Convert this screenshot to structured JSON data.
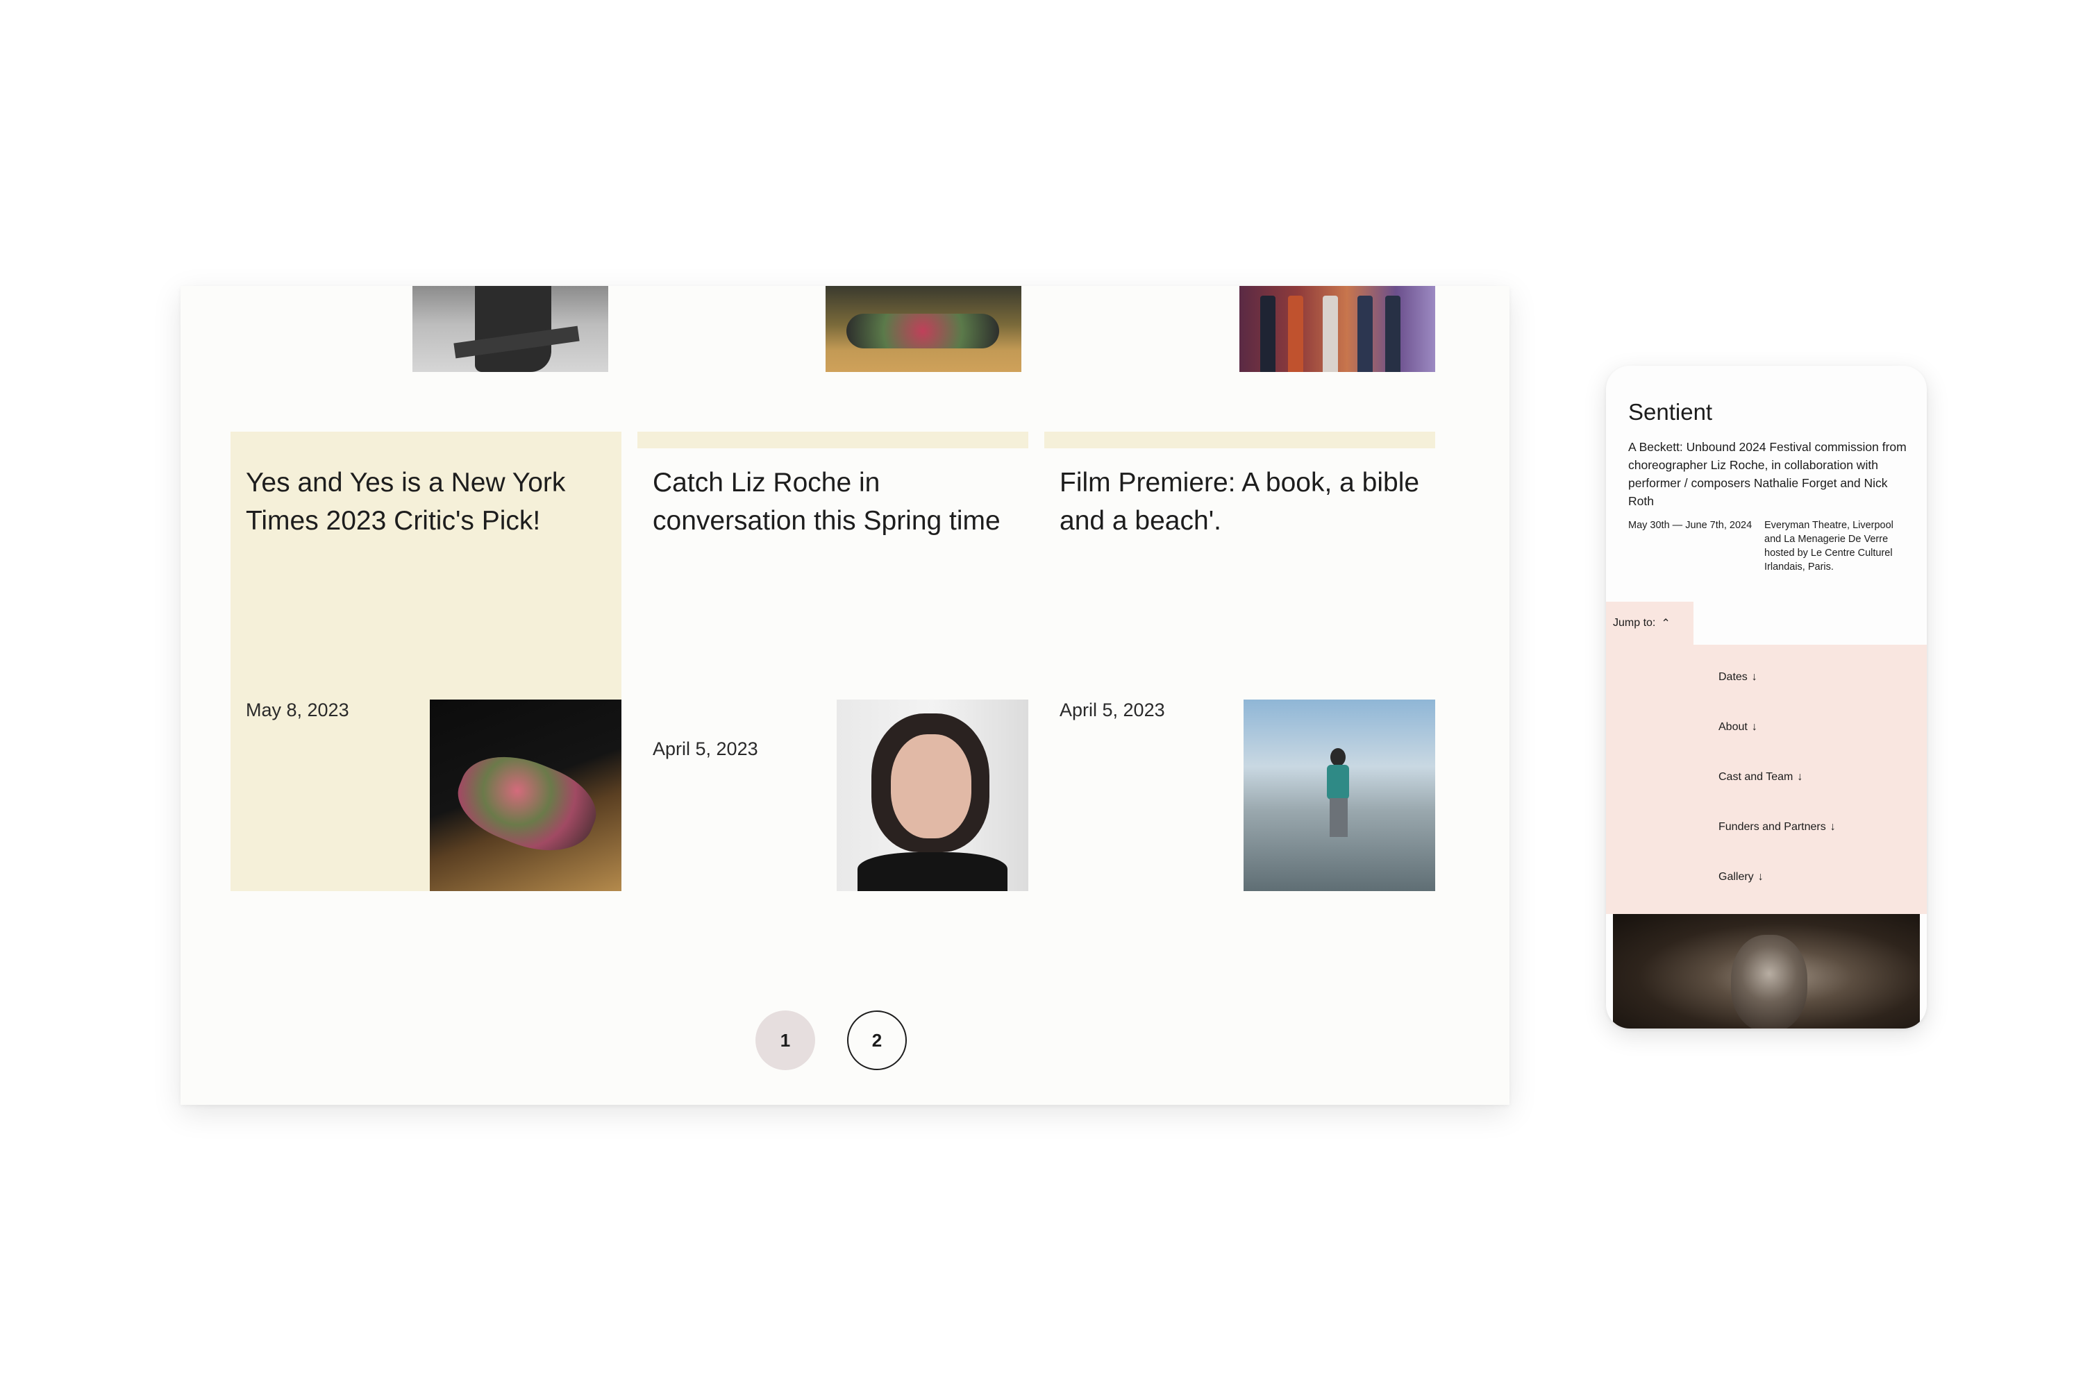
{
  "desktop": {
    "articles": [
      {
        "title": "Yes and Yes is a New York Times 2023 Critic's Pick!",
        "date": "May 8, 2023"
      },
      {
        "title": "Catch Liz Roche in conversation this Spring time",
        "date": "April 5, 2023"
      },
      {
        "title": "Film Premiere: A book, a bible and a beach'.",
        "date": "April 5, 2023"
      }
    ],
    "pagination": {
      "pages": [
        "1",
        "2"
      ],
      "current": "1"
    }
  },
  "mobile": {
    "title": "Sentient",
    "description": "A Beckett: Unbound 2024 Festival commission from choreographer Liz Roche, in collaboration with performer / composers Nathalie Forget and Nick Roth",
    "dates": "May 30th — June 7th, 2024",
    "venue": "Everyman Theatre, Liverpool and La Menagerie De Verre hosted by Le Centre Culturel Irlandais, Paris.",
    "jump_label": "Jump to:",
    "jump_items": [
      "Dates",
      "About",
      "Cast and Team",
      "Funders and Partners",
      "Gallery"
    ]
  },
  "colors": {
    "card_yellow": "#f5f0d9",
    "menu_pink": "#f9e6e0",
    "pager_active": "#e6dede"
  },
  "icons": {
    "jump_toggle": "chevron-up-icon",
    "jump_item": "arrow-down-icon"
  }
}
